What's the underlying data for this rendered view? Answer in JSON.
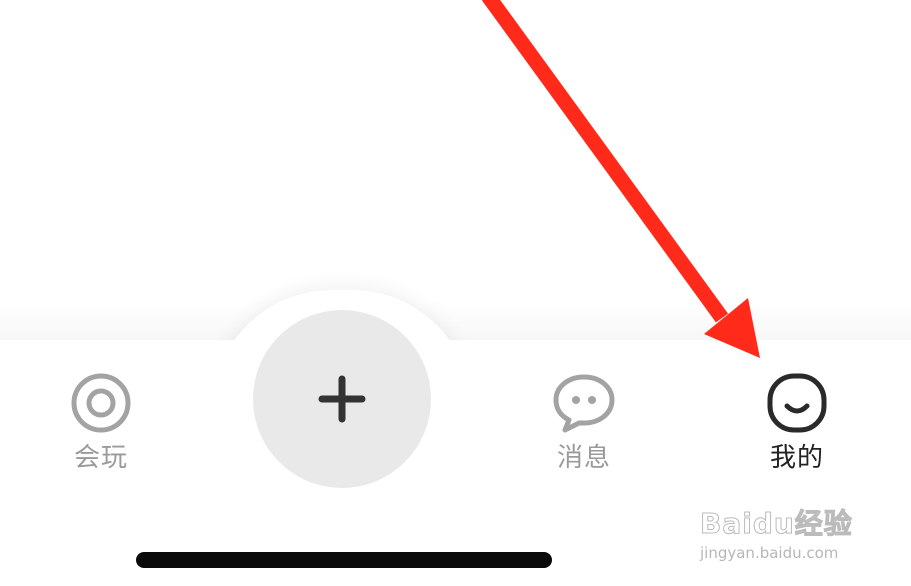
{
  "tabbar": {
    "tabs": [
      {
        "label": "会玩",
        "icon": "target-icon",
        "active": false
      },
      {
        "label": "消息",
        "icon": "chat-bubble-icon",
        "active": false
      },
      {
        "label": "我的",
        "icon": "smile-face-icon",
        "active": true
      }
    ],
    "center_button": {
      "icon": "plus-icon"
    }
  },
  "overlay": {
    "arrow_color": "#ff2a1a",
    "arrow_target": "tab 我的"
  },
  "watermark": {
    "logo": "Baidu经验",
    "url": "jingyan.baidu.com"
  },
  "colors": {
    "inactive": "#9a9a9a",
    "active": "#222222",
    "center_button_bg": "#e9e9e9"
  }
}
